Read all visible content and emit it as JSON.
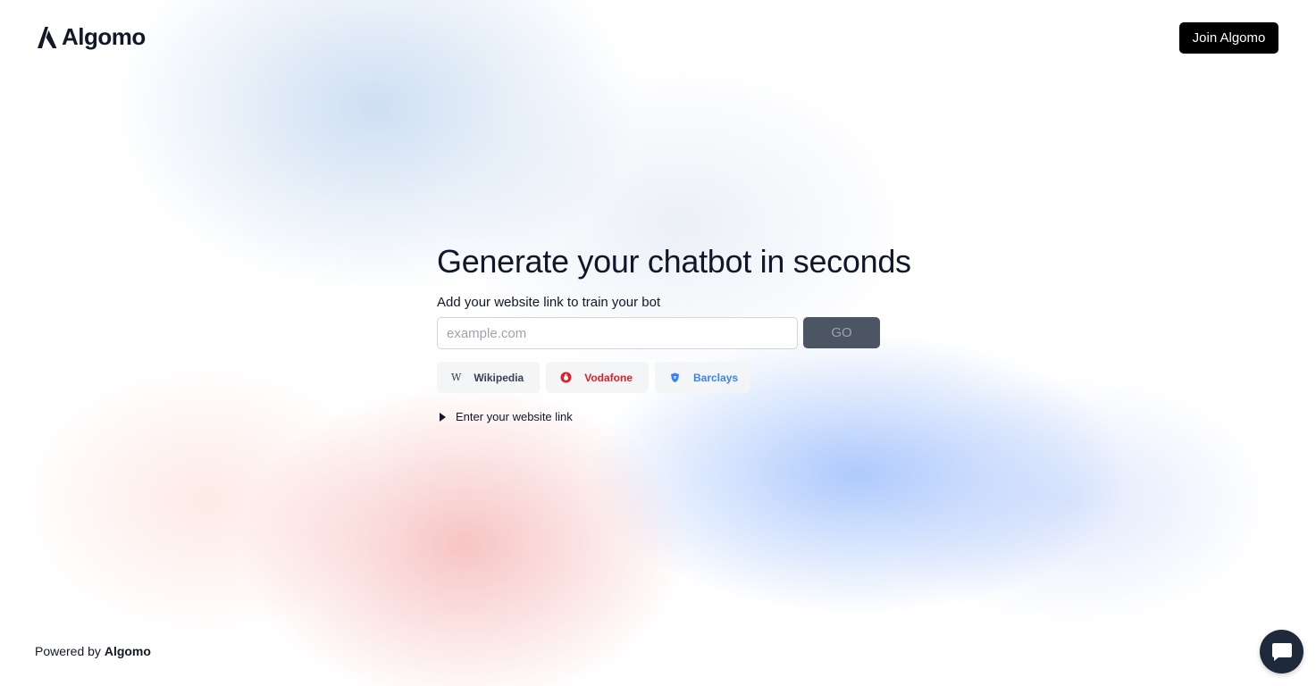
{
  "header": {
    "logo_text": "Algomo",
    "join_label": "Join Algomo"
  },
  "main": {
    "title": "Generate your chatbot in seconds",
    "subtitle": "Add your website link to train your bot",
    "input": {
      "value": "",
      "placeholder": "example.com"
    },
    "go_label": "GO",
    "examples": [
      {
        "label": "Wikipedia",
        "icon": "wikipedia-icon",
        "color": "#374151"
      },
      {
        "label": "Vodafone",
        "icon": "vodafone-icon",
        "color": "#e11d28"
      },
      {
        "label": "Barclays",
        "icon": "barclays-icon",
        "color": "#3b82f6"
      }
    ],
    "disclosure_label": "Enter your website link"
  },
  "footer": {
    "powered_prefix": "Powered by",
    "powered_brand": "Algomo"
  },
  "chat_widget": {
    "icon": "chat-bubble-icon"
  },
  "colors": {
    "primary_button": "#000000",
    "go_button": "#4b5563",
    "chat_widget": "#1e293b"
  }
}
